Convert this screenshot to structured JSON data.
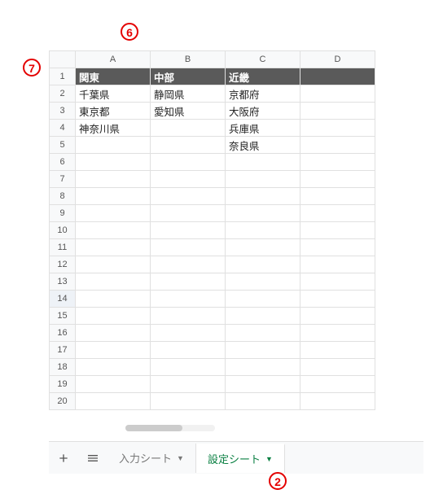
{
  "annotations": {
    "top": "6",
    "left": "7",
    "bottom": "2"
  },
  "columns": [
    "A",
    "B",
    "C",
    "D"
  ],
  "rowCount": 20,
  "selectedRow": 14,
  "headerRow": [
    "関東",
    "中部",
    "近畿",
    ""
  ],
  "dataRows": [
    [
      "千葉県",
      "静岡県",
      "京都府",
      ""
    ],
    [
      "東京都",
      "愛知県",
      "大阪府",
      ""
    ],
    [
      "神奈川県",
      "",
      "兵庫県",
      ""
    ],
    [
      "",
      "",
      "奈良県",
      ""
    ]
  ],
  "tabs": {
    "inactive": "入力シート",
    "active": "設定シート"
  }
}
